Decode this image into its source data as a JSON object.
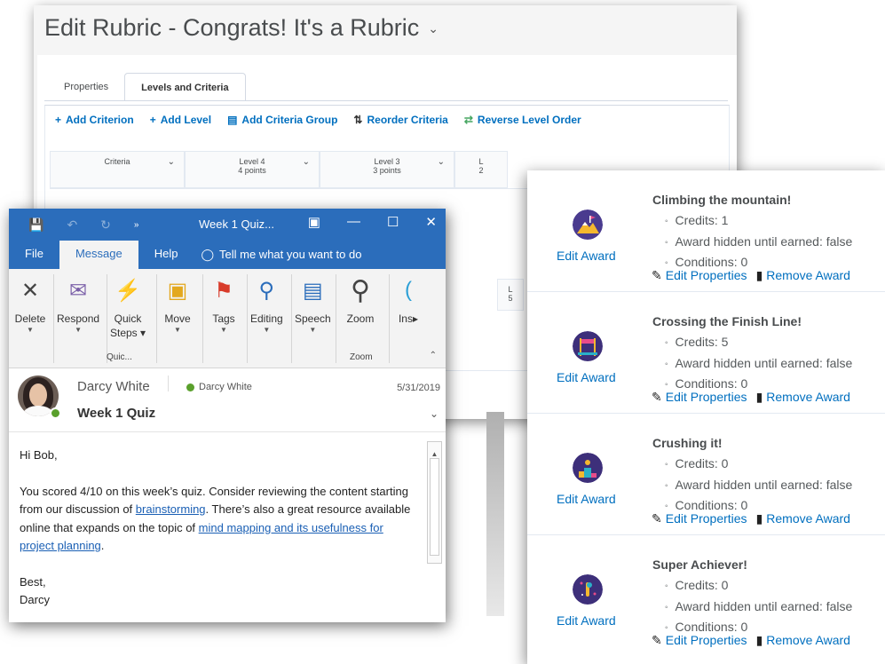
{
  "rubric": {
    "title": "Edit Rubric - Congrats! It's a Rubric",
    "tabs": [
      "Properties",
      "Levels and Criteria"
    ],
    "toolbar": [
      {
        "icon": "plus-icon",
        "symbol": "+",
        "label": "Add Criterion"
      },
      {
        "icon": "plus-icon",
        "symbol": "+",
        "label": "Add Level"
      },
      {
        "icon": "criteria-group-icon",
        "symbol": "▤",
        "label": "Add Criteria Group"
      },
      {
        "icon": "reorder-icon",
        "symbol": "⇅",
        "label": "Reorder Criteria"
      },
      {
        "icon": "reverse-icon",
        "symbol": "⇄",
        "label": "Reverse Level Order"
      }
    ],
    "columns": [
      {
        "title": "Criteria",
        "sub": ""
      },
      {
        "title": "Level 4",
        "sub": "4 points"
      },
      {
        "title": "Level 3",
        "sub": "3 points"
      },
      {
        "title": "L",
        "sub": "2"
      }
    ],
    "side_cell": {
      "title": "L",
      "sub": "5"
    }
  },
  "outlook": {
    "window_title": "Week 1 Quiz...",
    "tabs": [
      "File",
      "Message",
      "Help"
    ],
    "active_tab": "Message",
    "tell_me": "Tell me what you want to do",
    "ribbon": [
      {
        "name": "delete",
        "label": "Delete",
        "icon": "✕"
      },
      {
        "name": "respond",
        "label": "Respond",
        "icon": "✉"
      },
      {
        "name": "quick-steps",
        "label": "Quick\nSteps",
        "icon": "⚡"
      },
      {
        "name": "move",
        "label": "Move",
        "icon": "▣"
      },
      {
        "name": "tags",
        "label": "Tags",
        "icon": "⚑"
      },
      {
        "name": "editing",
        "label": "Editing",
        "icon": "⌕"
      },
      {
        "name": "speech",
        "label": "Speech",
        "icon": "▢"
      },
      {
        "name": "zoom",
        "label": "Zoom",
        "icon": "⌕"
      },
      {
        "name": "insights",
        "label": "Ins",
        "icon": "("
      }
    ],
    "groups": {
      "quick": "Quic...",
      "zoom": "Zoom"
    },
    "sender": "Darcy White",
    "sender_presence": "Darcy White",
    "date": "5/31/2019",
    "subject": "Week 1 Quiz",
    "body": {
      "greeting": "Hi Bob,",
      "p1_a": "You scored 4/10 on this week’s quiz. Consider reviewing the content starting from our discussion of ",
      "link1": "brainstorming",
      "p1_b": ". There’s also a great resource available online that expands on the topic of ",
      "link2": "mind mapping and its usefulness for project planning",
      "p1_c": ".",
      "closing": "Best,",
      "signature": "Darcy"
    }
  },
  "awards": {
    "edit_label": "Edit Award",
    "edit_properties": "Edit Properties",
    "remove_award": "Remove Award",
    "items": [
      {
        "name": "Climbing the mountain!",
        "credits": "Credits: 1",
        "hidden": "Award hidden until earned: false",
        "conditions": "Conditions: 0",
        "badge_color": "#4a3b8f"
      },
      {
        "name": "Crossing the Finish Line!",
        "credits": "Credits: 5",
        "hidden": "Award hidden until earned: false",
        "conditions": "Conditions: 0",
        "badge_color": "#3d2f7a"
      },
      {
        "name": "Crushing it!",
        "credits": "Credits: 0",
        "hidden": "Award hidden until earned: false",
        "conditions": "Conditions: 0",
        "badge_color": "#3d2f7a"
      },
      {
        "name": "Super Achiever!",
        "credits": "Credits: 0",
        "hidden": "Award hidden until earned: false",
        "conditions": "Conditions: 0",
        "badge_color": "#3d2f7a"
      }
    ]
  },
  "colors": {
    "outlook_blue": "#2b6dbb",
    "link_blue": "#006fbf",
    "presence_green": "#5aa02c"
  }
}
